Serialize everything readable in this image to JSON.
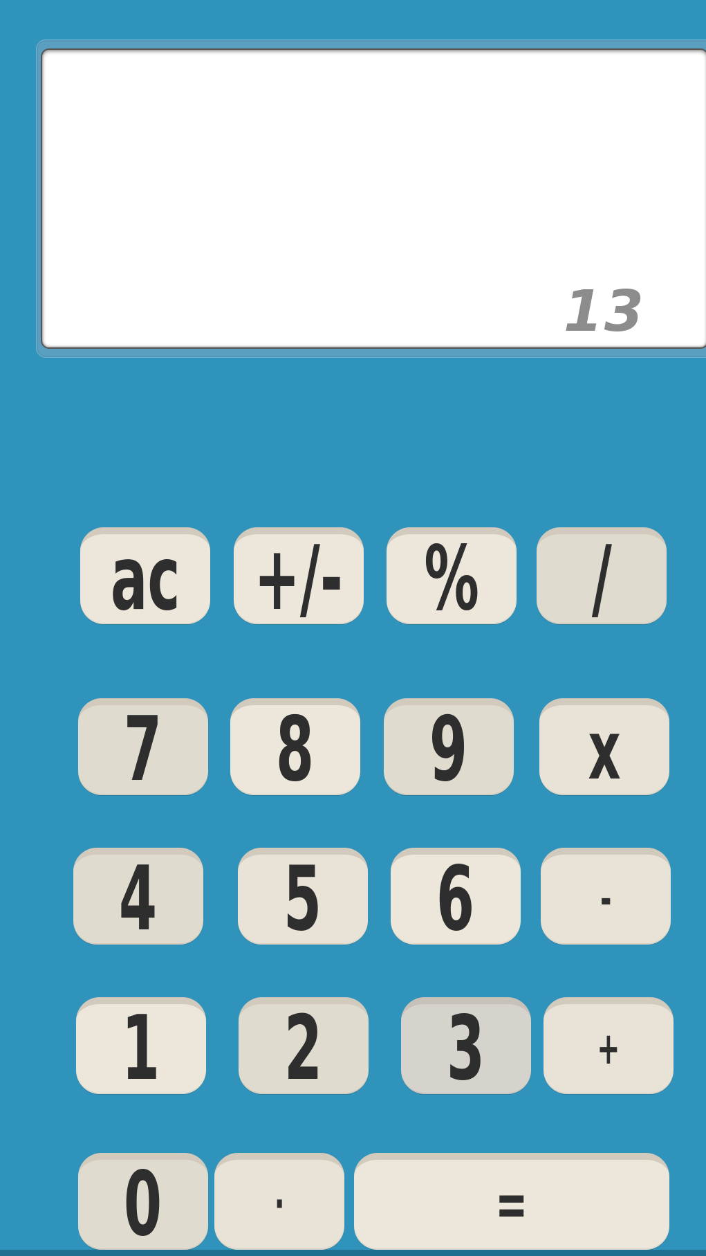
{
  "display": {
    "value": "13"
  },
  "keys": {
    "ac": "ac",
    "sign": "+/-",
    "percent": "%",
    "divide": "/",
    "seven": "7",
    "eight": "8",
    "nine": "9",
    "multiply": "x",
    "four": "4",
    "five": "5",
    "six": "6",
    "minus": "-",
    "one": "1",
    "two": "2",
    "three": "3",
    "plus": "+",
    "zero": "0",
    "decimal": "·",
    "equals": "="
  },
  "colors": {
    "background": "#3093bb",
    "key_face": "#e9e3d5",
    "key_text": "#2e2e2e",
    "display_text": "#8c8c8c"
  }
}
